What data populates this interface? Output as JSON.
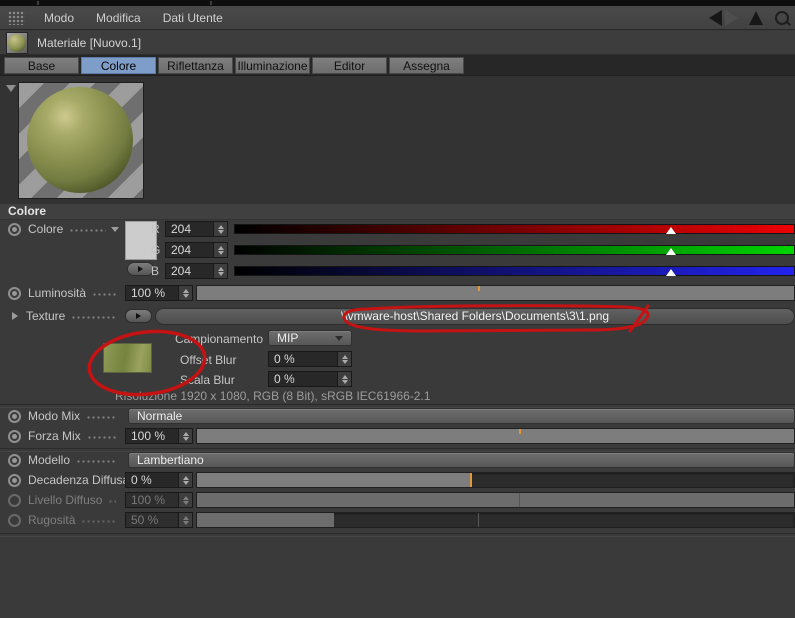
{
  "menubar": {
    "items": [
      {
        "label": "Modo"
      },
      {
        "label": "Modifica"
      },
      {
        "label": "Dati Utente"
      }
    ]
  },
  "titlebar": {
    "title": "Materiale [Nuovo.1]"
  },
  "tabs": {
    "active": "Colore",
    "active_color": "#7e9ec9",
    "items": [
      {
        "label": "Base"
      },
      {
        "label": "Colore"
      },
      {
        "label": "Riflettanza"
      },
      {
        "label": "Illuminazione"
      },
      {
        "label": "Editor"
      },
      {
        "label": "Assegna"
      }
    ]
  },
  "section": {
    "header": "Colore"
  },
  "rows": {
    "color": {
      "label": "Colore",
      "swatch_hex": "#cccccc",
      "channels": [
        {
          "name": "R",
          "value": "204",
          "slider_end_color": "#ee0000",
          "marker_pct": 80
        },
        {
          "name": "G",
          "value": "204",
          "slider_end_color": "#00d400",
          "marker_pct": 80
        },
        {
          "name": "B",
          "value": "204",
          "slider_end_color": "#2323ee",
          "marker_pct": 80
        }
      ]
    },
    "luminosita": {
      "label": "Luminosità",
      "value": "100 %",
      "slider_fill_pct": 100
    },
    "texture": {
      "label": "Texture",
      "path": "\\\\vmware-host\\Shared Folders\\Documents\\3\\1.png"
    },
    "campionamento": {
      "label": "Campionamento",
      "value": "MIP"
    },
    "offset_blur": {
      "label": "Offset Blur",
      "value": "0 %"
    },
    "scala_blur": {
      "label": "Scala Blur",
      "value": "0 %"
    },
    "risoluzione": {
      "text": "Risoluzione 1920 x 1080, RGB (8 Bit), sRGB IEC61966-2.1"
    },
    "modo_mix": {
      "label": "Modo Mix",
      "value": "Normale"
    },
    "forza_mix": {
      "label": "Forza Mix",
      "value": "100 %",
      "slider_fill_pct": 100
    },
    "modello": {
      "label": "Modello",
      "value": "Lambertiano"
    },
    "decadenza_diffusa": {
      "label": "Decadenza Diffusa",
      "value": "0 %",
      "slider_fill_pct": 46
    },
    "livello_diffuso": {
      "label": "Livello Diffuso",
      "value": "100 %",
      "slider_fill_pct": 100,
      "disabled": true
    },
    "rugosita": {
      "label": "Rugosità",
      "value": "50 %",
      "slider_fill_pct": 23,
      "disabled": true
    }
  },
  "annotation": {
    "color": "#c51212",
    "shapes": [
      "ellipse-around-texture-thumbnail",
      "loop-around-texture-path"
    ]
  },
  "accents": {
    "slider_tick_orange": "#e09a35"
  }
}
